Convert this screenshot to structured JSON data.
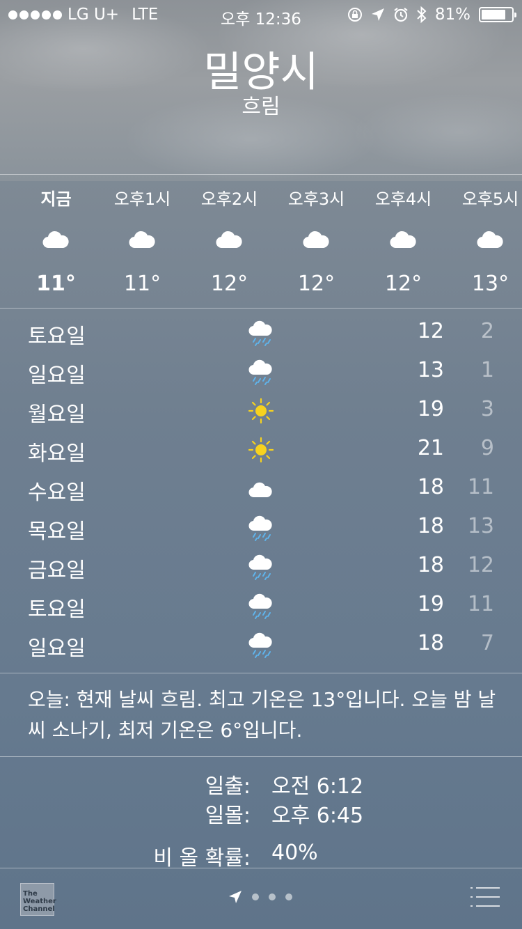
{
  "status_bar": {
    "carrier": "LG U+",
    "network": "LTE",
    "time": "오후 12:36",
    "battery": "81%",
    "battery_level": 0.81
  },
  "location": {
    "city": "밀양시",
    "condition": "흐림"
  },
  "hourly": [
    {
      "time": "지금",
      "icon": "cloud-icon",
      "temp": "11°"
    },
    {
      "time": "오후1시",
      "icon": "cloud-icon",
      "temp": "11°"
    },
    {
      "time": "오후2시",
      "icon": "cloud-icon",
      "temp": "12°"
    },
    {
      "time": "오후3시",
      "icon": "cloud-icon",
      "temp": "12°"
    },
    {
      "time": "오후4시",
      "icon": "cloud-icon",
      "temp": "12°"
    },
    {
      "time": "오후5시",
      "icon": "cloud-icon",
      "temp": "13°"
    }
  ],
  "daily": [
    {
      "day": "토요일",
      "icon": "rain-cloud-icon",
      "high": "12",
      "low": "2"
    },
    {
      "day": "일요일",
      "icon": "rain-cloud-icon",
      "high": "13",
      "low": "1"
    },
    {
      "day": "월요일",
      "icon": "sun-icon",
      "high": "19",
      "low": "3"
    },
    {
      "day": "화요일",
      "icon": "sun-icon",
      "high": "21",
      "low": "9"
    },
    {
      "day": "수요일",
      "icon": "cloud-icon",
      "high": "18",
      "low": "11"
    },
    {
      "day": "목요일",
      "icon": "rain-cloud-icon",
      "high": "18",
      "low": "13"
    },
    {
      "day": "금요일",
      "icon": "rain-cloud-icon",
      "high": "18",
      "low": "12"
    },
    {
      "day": "토요일",
      "icon": "rain-cloud-icon",
      "high": "19",
      "low": "11"
    },
    {
      "day": "일요일",
      "icon": "rain-cloud-icon",
      "high": "18",
      "low": "7"
    }
  ],
  "summary": "오늘: 현재 날씨 흐림. 최고 기온은 13°입니다. 오늘 밤 날씨 소나기, 최저 기온은 6°입니다.",
  "details": [
    {
      "label": "일출:",
      "value": "오전 6:12"
    },
    {
      "label": "일몰:",
      "value": "오후 6:45"
    },
    {
      "label": "비 올 확률:",
      "value": "40%"
    }
  ],
  "footer": {
    "logo_text": "The Weather Channel",
    "page_count": 3
  },
  "colors": {
    "sun": "#f7d21e",
    "rain": "#5fb4ec",
    "cloud": "#ffffff"
  }
}
